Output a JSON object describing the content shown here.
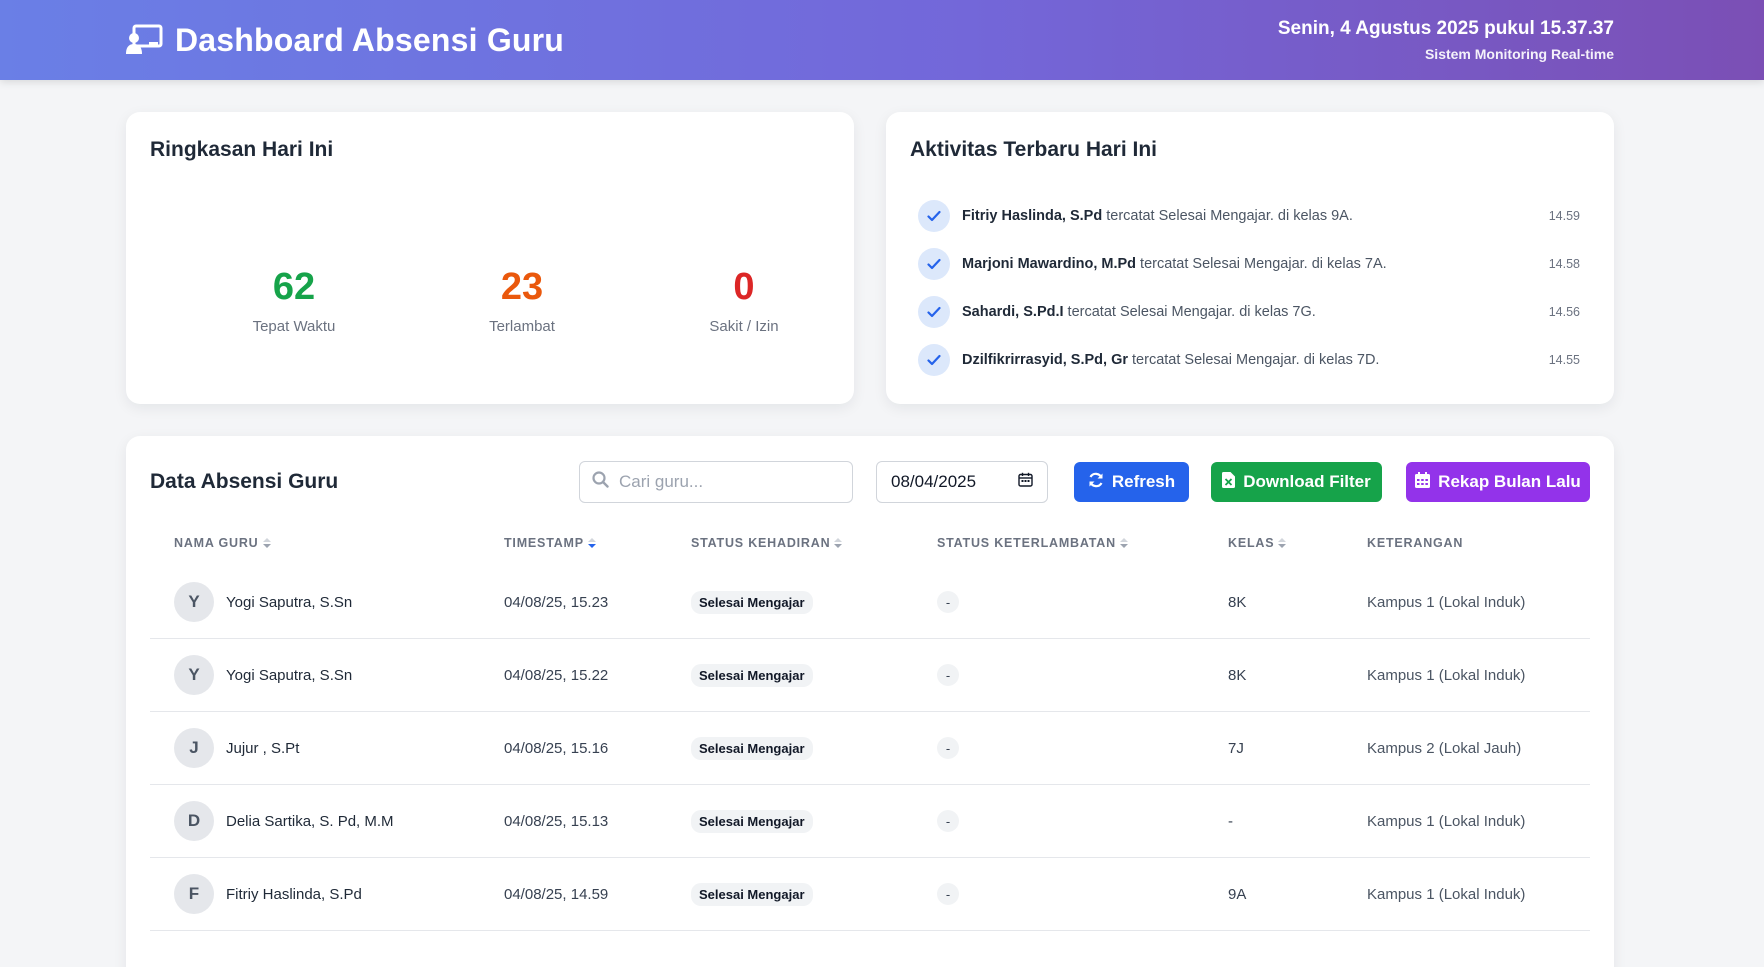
{
  "header": {
    "title": "Dashboard Absensi Guru",
    "datetime": "Senin, 4 Agustus 2025 pukul 15.37.37",
    "subtitle": "Sistem Monitoring Real-time"
  },
  "summary": {
    "title": "Ringkasan Hari Ini",
    "stats": [
      {
        "value": "62",
        "label": "Tepat Waktu",
        "color": "#16a34a"
      },
      {
        "value": "23",
        "label": "Terlambat",
        "color": "#ea580c"
      },
      {
        "value": "0",
        "label": "Sakit / Izin",
        "color": "#dc2626"
      }
    ]
  },
  "activity": {
    "title": "Aktivitas Terbaru Hari Ini",
    "items": [
      {
        "name": "Fitriy Haslinda, S.Pd",
        "text": " tercatat Selesai Mengajar. di kelas 9A.",
        "time": "14.59"
      },
      {
        "name": "Marjoni Mawardino, M.Pd",
        "text": " tercatat Selesai Mengajar. di kelas 7A.",
        "time": "14.58"
      },
      {
        "name": "Sahardi, S.Pd.I",
        "text": " tercatat Selesai Mengajar. di kelas 7G.",
        "time": "14.56"
      },
      {
        "name": "Dzilfikrirrasyid, S.Pd, Gr",
        "text": " tercatat Selesai Mengajar. di kelas 7D.",
        "time": "14.55"
      }
    ]
  },
  "table": {
    "title": "Data Absensi Guru",
    "search_placeholder": "Cari guru...",
    "date_value": "08/04/2025",
    "buttons": {
      "refresh": "Refresh",
      "download": "Download Filter",
      "rekap": "Rekap Bulan Lalu"
    },
    "columns": {
      "nama": "NAMA GURU",
      "timestamp": "TIMESTAMP",
      "status_kehadiran": "STATUS KEHADIRAN",
      "status_keterlambatan": "STATUS KETERLAMBATAN",
      "kelas": "KELAS",
      "keterangan": "KETERANGAN"
    },
    "rows": [
      {
        "initial": "Y",
        "name": "Yogi Saputra, S.Sn",
        "timestamp": "04/08/25, 15.23",
        "status": "Selesai Mengajar",
        "late": "-",
        "kelas": "8K",
        "ket": "Kampus 1 (Lokal Induk)"
      },
      {
        "initial": "Y",
        "name": "Yogi Saputra, S.Sn",
        "timestamp": "04/08/25, 15.22",
        "status": "Selesai Mengajar",
        "late": "-",
        "kelas": "8K",
        "ket": "Kampus 1 (Lokal Induk)"
      },
      {
        "initial": "J",
        "name": "Jujur , S.Pt",
        "timestamp": "04/08/25, 15.16",
        "status": "Selesai Mengajar",
        "late": "-",
        "kelas": "7J",
        "ket": "Kampus 2 (Lokal Jauh)"
      },
      {
        "initial": "D",
        "name": "Delia Sartika, S. Pd, M.M",
        "timestamp": "04/08/25, 15.13",
        "status": "Selesai Mengajar",
        "late": "-",
        "kelas": "-",
        "ket": "Kampus 1 (Lokal Induk)"
      },
      {
        "initial": "F",
        "name": "Fitriy Haslinda, S.Pd",
        "timestamp": "04/08/25, 14.59",
        "status": "Selesai Mengajar",
        "late": "-",
        "kelas": "9A",
        "ket": "Kampus 1 (Lokal Induk)"
      }
    ]
  }
}
